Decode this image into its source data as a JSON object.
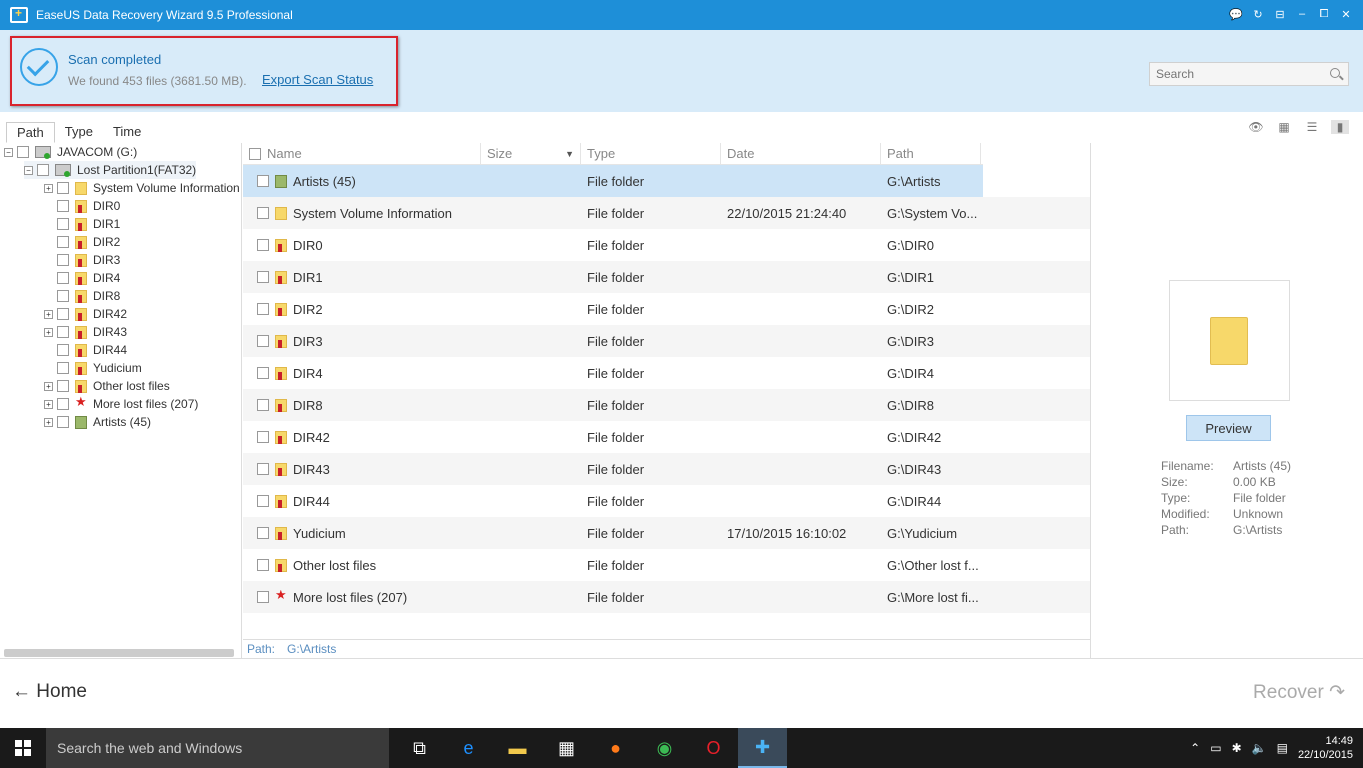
{
  "window": {
    "title": "EaseUS Data Recovery Wizard 9.5 Professional",
    "controls": [
      "💬",
      "↻",
      "⊟",
      "–",
      "⧠",
      "✕"
    ]
  },
  "scan": {
    "title": "Scan completed",
    "summary": "We found 453 files (3681.50 MB).",
    "export_label": "Export Scan Status"
  },
  "search": {
    "placeholder": "Search",
    "value": ""
  },
  "tabs": [
    {
      "label": "Path",
      "active": true
    },
    {
      "label": "Type",
      "active": false
    },
    {
      "label": "Time",
      "active": false
    }
  ],
  "view_icons": [
    "eye-icon",
    "thumbnail-view-icon",
    "list-view-icon",
    "preview-pane-icon"
  ],
  "tree": {
    "drive": "JAVACOM (G:)",
    "partition": "Lost Partition1(FAT32)",
    "items": [
      {
        "label": "System Volume Information",
        "icon": "yellow",
        "expandable": true
      },
      {
        "label": "DIR0",
        "icon": "red",
        "expandable": false
      },
      {
        "label": "DIR1",
        "icon": "red",
        "expandable": false
      },
      {
        "label": "DIR2",
        "icon": "red",
        "expandable": false
      },
      {
        "label": "DIR3",
        "icon": "red",
        "expandable": false
      },
      {
        "label": "DIR4",
        "icon": "red",
        "expandable": false
      },
      {
        "label": "DIR8",
        "icon": "red",
        "expandable": false
      },
      {
        "label": "DIR42",
        "icon": "red",
        "expandable": true
      },
      {
        "label": "DIR43",
        "icon": "red",
        "expandable": true
      },
      {
        "label": "DIR44",
        "icon": "red",
        "expandable": false
      },
      {
        "label": "Yudicium",
        "icon": "red",
        "expandable": false
      },
      {
        "label": "Other lost files",
        "icon": "red",
        "expandable": true
      },
      {
        "label": "More lost files (207)",
        "icon": "star",
        "expandable": true
      },
      {
        "label": "Artists (45)",
        "icon": "book",
        "expandable": true
      }
    ]
  },
  "columns": {
    "name": "Name",
    "size": "Size",
    "type": "Type",
    "date": "Date",
    "path": "Path"
  },
  "files": [
    {
      "name": "Artists (45)",
      "icon": "book",
      "size": "",
      "type": "File folder",
      "date": "",
      "path": "G:\\Artists",
      "selected": true
    },
    {
      "name": "System Volume Information",
      "icon": "yellow",
      "size": "",
      "type": "File folder",
      "date": "22/10/2015 21:24:40",
      "path": "G:\\System Vo..."
    },
    {
      "name": "DIR0",
      "icon": "red",
      "size": "",
      "type": "File folder",
      "date": "",
      "path": "G:\\DIR0"
    },
    {
      "name": "DIR1",
      "icon": "red",
      "size": "",
      "type": "File folder",
      "date": "",
      "path": "G:\\DIR1"
    },
    {
      "name": "DIR2",
      "icon": "red",
      "size": "",
      "type": "File folder",
      "date": "",
      "path": "G:\\DIR2"
    },
    {
      "name": "DIR3",
      "icon": "red",
      "size": "",
      "type": "File folder",
      "date": "",
      "path": "G:\\DIR3"
    },
    {
      "name": "DIR4",
      "icon": "red",
      "size": "",
      "type": "File folder",
      "date": "",
      "path": "G:\\DIR4"
    },
    {
      "name": "DIR8",
      "icon": "red",
      "size": "",
      "type": "File folder",
      "date": "",
      "path": "G:\\DIR8"
    },
    {
      "name": "DIR42",
      "icon": "red",
      "size": "",
      "type": "File folder",
      "date": "",
      "path": "G:\\DIR42"
    },
    {
      "name": "DIR43",
      "icon": "red",
      "size": "",
      "type": "File folder",
      "date": "",
      "path": "G:\\DIR43"
    },
    {
      "name": "DIR44",
      "icon": "red",
      "size": "",
      "type": "File folder",
      "date": "",
      "path": "G:\\DIR44"
    },
    {
      "name": "Yudicium",
      "icon": "red",
      "size": "",
      "type": "File folder",
      "date": "17/10/2015 16:10:02",
      "path": "G:\\Yudicium"
    },
    {
      "name": "Other lost files",
      "icon": "red",
      "size": "",
      "type": "File folder",
      "date": "",
      "path": "G:\\Other lost f..."
    },
    {
      "name": "More lost files (207)",
      "icon": "star",
      "size": "",
      "type": "File folder",
      "date": "",
      "path": "G:\\More lost fi..."
    }
  ],
  "status_path": {
    "label": "Path:",
    "value": "G:\\Artists"
  },
  "preview": {
    "button": "Preview",
    "info": [
      {
        "label": "Filename:",
        "value": "Artists (45)"
      },
      {
        "label": "Size:",
        "value": "0.00 KB"
      },
      {
        "label": "Type:",
        "value": "File folder"
      },
      {
        "label": "Modified:",
        "value": "Unknown"
      },
      {
        "label": "Path:",
        "value": "G:\\Artists"
      }
    ]
  },
  "footer": {
    "home": "Home",
    "recover": "Recover"
  },
  "taskbar": {
    "search_placeholder": "Search the web and Windows",
    "apps": [
      {
        "name": "task-view-icon",
        "glyph": "⧉",
        "color": "#ffffff"
      },
      {
        "name": "edge-icon",
        "glyph": "e",
        "color": "#1e90ff"
      },
      {
        "name": "file-explorer-icon",
        "glyph": "▬",
        "color": "#f2c94c"
      },
      {
        "name": "store-icon",
        "glyph": "▦",
        "color": "#ffffff"
      },
      {
        "name": "firefox-icon",
        "glyph": "●",
        "color": "#ff7a1a"
      },
      {
        "name": "chrome-icon",
        "glyph": "◉",
        "color": "#3cba54"
      },
      {
        "name": "opera-icon",
        "glyph": "O",
        "color": "#e8202a"
      },
      {
        "name": "easeus-icon",
        "glyph": "✚",
        "color": "#4ab3f4",
        "active": true
      }
    ],
    "time": "14:49",
    "date": "22/10/2015"
  }
}
